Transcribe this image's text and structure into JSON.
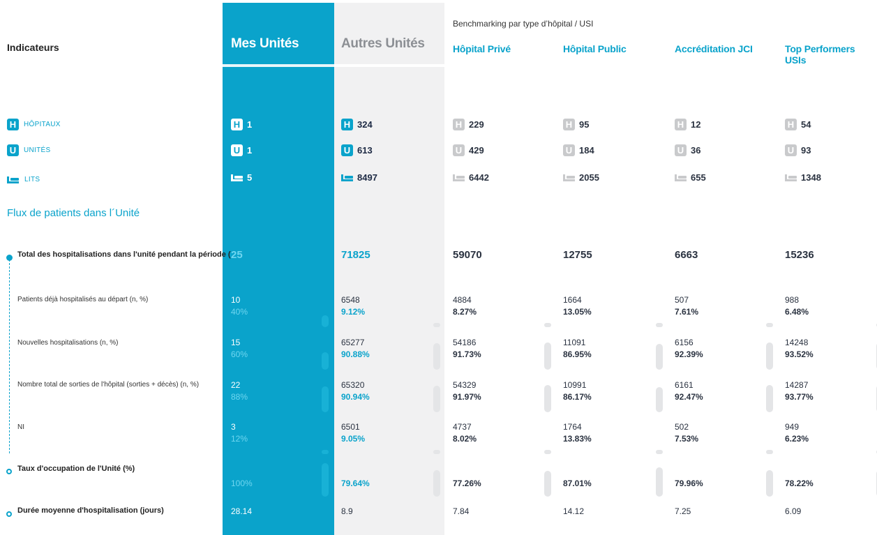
{
  "header": {
    "indicators": "Indicateurs",
    "mine": "Mes Unités",
    "others": "Autres Unités",
    "bench_caption": "Benchmarking par type d’hôpital / USI",
    "bench": [
      "Hôpital Privé",
      "Hôpital Public",
      "Accréditation JCI",
      "Top Performers USIs"
    ]
  },
  "counts": {
    "hospitals_label": "HÔPITAUX",
    "units_label": "UNITÉS",
    "beds_label": "LITS",
    "hospital_icon_letter": "H",
    "unit_icon_letter": "U",
    "hospitals": [
      "1",
      "324",
      "229",
      "95",
      "12",
      "54"
    ],
    "units": [
      "1",
      "613",
      "429",
      "184",
      "36",
      "93"
    ],
    "beds": [
      "5",
      "8497",
      "6442",
      "2055",
      "655",
      "1348"
    ]
  },
  "section_title": "Flux de patients dans l´Unité",
  "rows": {
    "total": {
      "label": "Total des hospitalisations dans l'unité pendant la période (",
      "values": [
        "25",
        "71825",
        "59070",
        "12755",
        "6663",
        "15236"
      ]
    },
    "already": {
      "label": "Patients déjà hospitalisés au départ (n, %)",
      "n": [
        "10",
        "6548",
        "4884",
        "1664",
        "507",
        "988"
      ],
      "pct": [
        "40%",
        "9.12%",
        "8.27%",
        "13.05%",
        "7.61%",
        "6.48%"
      ]
    },
    "new": {
      "label": "Nouvelles hospitalisations (n, %)",
      "n": [
        "15",
        "65277",
        "54186",
        "11091",
        "6156",
        "14248"
      ],
      "pct": [
        "60%",
        "90.88%",
        "91.73%",
        "86.95%",
        "92.39%",
        "93.52%"
      ]
    },
    "exits": {
      "label": "Nombre total de sorties de l'hôpital (sorties + décès) (n, %)",
      "n": [
        "22",
        "65320",
        "54329",
        "10991",
        "6161",
        "14287"
      ],
      "pct": [
        "88%",
        "90.94%",
        "91.97%",
        "86.17%",
        "92.47%",
        "93.77%"
      ]
    },
    "ni": {
      "label": "NI",
      "n": [
        "3",
        "6501",
        "4737",
        "1764",
        "502",
        "949"
      ],
      "pct": [
        "12%",
        "9.05%",
        "8.02%",
        "13.83%",
        "7.53%",
        "6.23%"
      ]
    },
    "occupancy": {
      "label": "Taux d'occupation de l'Unité (%)",
      "pct": [
        "100%",
        "79.64%",
        "77.26%",
        "87.01%",
        "79.96%",
        "78.22%"
      ]
    },
    "duration": {
      "label": "Durée moyenne d'hospitalisation (jours)",
      "values": [
        "28.14",
        "8.9",
        "7.84",
        "14.12",
        "7.25",
        "6.09"
      ]
    }
  },
  "colors": {
    "accent": "#0aa3cb",
    "dark_text": "#2a3240",
    "grey_bg": "#f1f1f2",
    "bar_grey": "#e4e5e7"
  }
}
